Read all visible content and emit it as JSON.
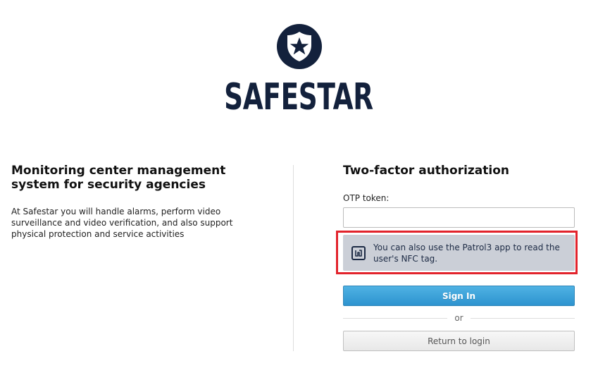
{
  "brand": {
    "name": "SAFESTAR",
    "logo_icon": "shield-star-icon",
    "color": "#13213c"
  },
  "intro": {
    "headline": "Monitoring center management system for security agencies",
    "description": "At Safestar you will handle alarms, perform video surveillance and video verification, and also support physical protection and service activities"
  },
  "form": {
    "title": "Two-factor authorization",
    "otp_label": "OTP token:",
    "otp_value": "",
    "otp_placeholder": "",
    "nfc_hint": "You can also use the Patrol3 app to read the user's NFC tag.",
    "nfc_icon": "nfc-icon",
    "sign_in_label": "Sign In",
    "or_label": "or",
    "return_label": "Return to login"
  },
  "colors": {
    "accent": "#2d93cf",
    "hint_background": "#cbcfd7",
    "highlight": "#e2232c"
  }
}
